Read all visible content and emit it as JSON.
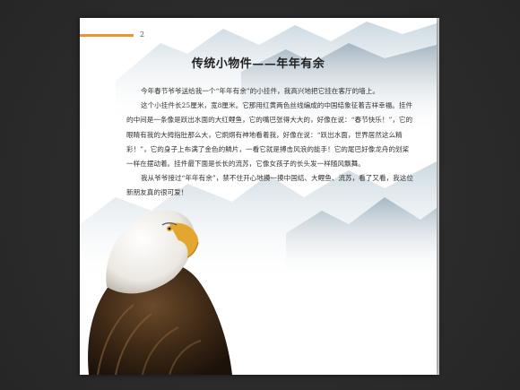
{
  "page": {
    "number": "2",
    "title": "传统小物件——年年有余",
    "accent_color": "#e8962e",
    "paragraphs": [
      "今年春节爷爷送给我一个“年年有余”的小挂件，我高兴地把它挂在客厅的墙上。",
      "这个小挂件长25厘米，宽8厘米。它那用红黄两色丝线编成的中国结象征着吉祥幸福。挂件的中间是一条像是跃出水面的大红鲤鱼，它的嘴巴张得大大的，好像在说：“春节快乐！”，它的眼睛有我的大拇指肚那么大，它炯炯有神地看着我，好像在说：“跃出水面，世界居然这么精彩！”，它的身子上布满了金色的鳞片，一看它就是搏击风浪的能手！它的尾巴好像龙舟的划桨一样在摆动着。挂件最下面是长长的流苏，它像女孩子的长头发一样随风飘舞。",
      "我从爷爷接过“年年有余”，禁不住开心地摸一摸中国结、大鲤鱼、流苏，看了又看，我这位新朋友真的很可爱！"
    ]
  }
}
